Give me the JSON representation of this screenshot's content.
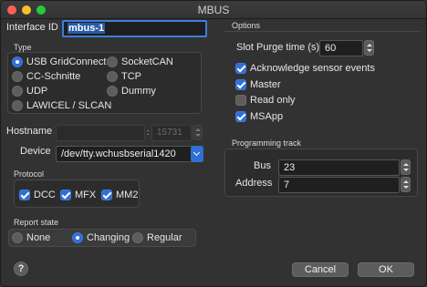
{
  "window": {
    "title": "MBUS"
  },
  "interface": {
    "label": "Interface ID",
    "value": "mbus-1"
  },
  "type_group": {
    "title": "Type",
    "options": [
      {
        "label": "USB GridConnect",
        "selected": true
      },
      {
        "label": "SocketCAN",
        "selected": false
      },
      {
        "label": "CC-Schnitte",
        "selected": false
      },
      {
        "label": "TCP",
        "selected": false
      },
      {
        "label": "UDP",
        "selected": false
      },
      {
        "label": "Dummy",
        "selected": false
      },
      {
        "label": "LAWICEL / SLCAN",
        "selected": false
      }
    ]
  },
  "hostname": {
    "label": "Hostname",
    "value": "",
    "port": "15731"
  },
  "device": {
    "label": "Device",
    "value": "/dev/tty.wchusbserial1420"
  },
  "protocol": {
    "title": "Protocol",
    "options": [
      {
        "label": "DCC",
        "checked": true
      },
      {
        "label": "MFX",
        "checked": true
      },
      {
        "label": "MM2",
        "checked": true
      }
    ]
  },
  "report_state": {
    "title": "Report state",
    "options": [
      {
        "label": "None",
        "selected": false
      },
      {
        "label": "Changing",
        "selected": true
      },
      {
        "label": "Regular",
        "selected": false
      }
    ]
  },
  "options": {
    "title": "Options",
    "slot_purge_label": "Slot Purge time (s)",
    "slot_purge_value": "60",
    "checks": [
      {
        "label": "Acknowledge sensor events",
        "checked": true
      },
      {
        "label": "Master",
        "checked": true
      },
      {
        "label": "Read only",
        "checked": false
      },
      {
        "label": "MSApp",
        "checked": true
      }
    ]
  },
  "programming": {
    "title": "Programming track",
    "bus_label": "Bus",
    "bus_value": "23",
    "address_label": "Address",
    "address_value": "7"
  },
  "buttons": {
    "help": "?",
    "cancel": "Cancel",
    "ok": "OK"
  }
}
